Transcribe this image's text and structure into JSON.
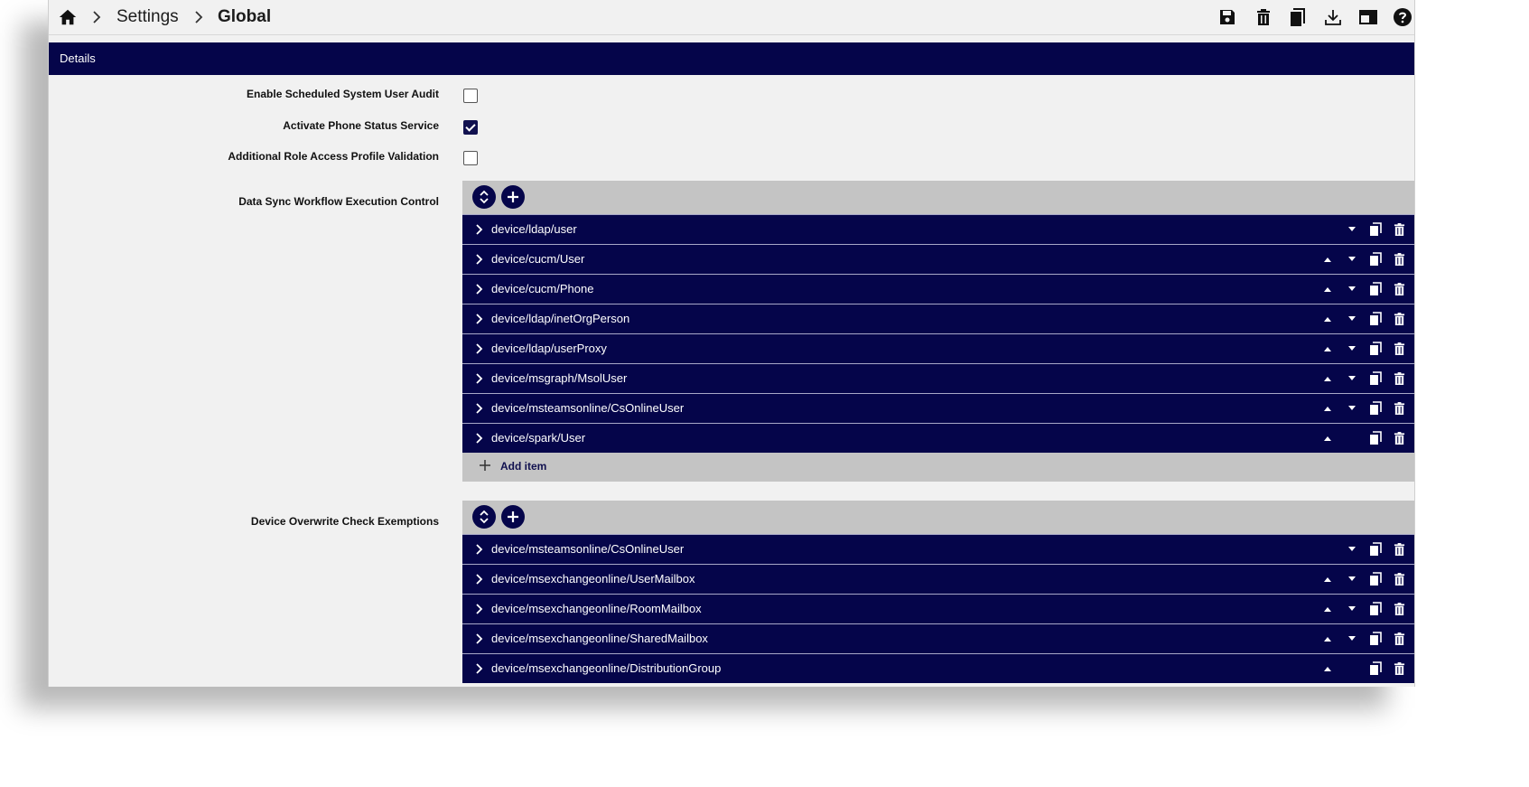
{
  "breadcrumb": {
    "home_icon": "home-icon",
    "items": [
      "Settings",
      "Global"
    ]
  },
  "toolbar": {
    "icons": [
      "save-icon",
      "delete-icon",
      "copy-icon",
      "download-icon",
      "panel-icon",
      "help-icon"
    ]
  },
  "section": {
    "title": "Details"
  },
  "fields": {
    "scheduled_audit": {
      "label": "Enable Scheduled System User Audit",
      "checked": false
    },
    "phone_status": {
      "label": "Activate Phone Status Service",
      "checked": true
    },
    "role_access": {
      "label": "Additional Role Access Profile Validation",
      "checked": false
    }
  },
  "data_sync": {
    "label": "Data Sync Workflow Execution Control",
    "items": [
      "device/ldap/user",
      "device/cucm/User",
      "device/cucm/Phone",
      "device/ldap/inetOrgPerson",
      "device/ldap/userProxy",
      "device/msgraph/MsolUser",
      "device/msteamsonline/CsOnlineUser",
      "device/spark/User"
    ],
    "add_label": "Add item"
  },
  "overwrite": {
    "label": "Device Overwrite Check Exemptions",
    "items": [
      "device/msteamsonline/CsOnlineUser",
      "device/msexchangeonline/UserMailbox",
      "device/msexchangeonline/RoomMailbox",
      "device/msexchangeonline/SharedMailbox",
      "device/msexchangeonline/DistributionGroup"
    ]
  },
  "colors": {
    "navy": "#05054a",
    "panel_gray": "#c4c4c4",
    "background": "#f1f1f1"
  }
}
